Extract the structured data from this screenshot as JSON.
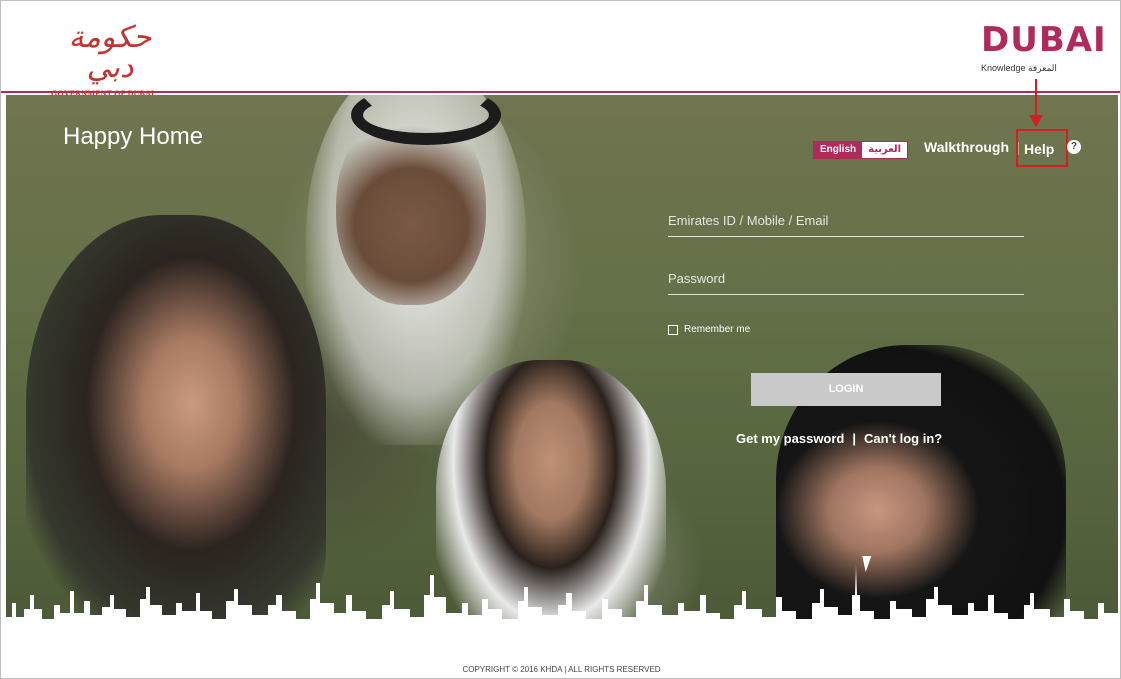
{
  "header": {
    "gov_logo_ar": "حكومة دبي",
    "gov_logo_en": "GOVERNMENT OF DUBAI",
    "kd_logo_main": "DUBAI",
    "kd_logo_sub": "Knowledge المعرفة"
  },
  "hero": {
    "title": "Happy Home"
  },
  "topnav": {
    "lang_en": "English",
    "lang_ar": "العربية",
    "walkthrough": "Walkthrough",
    "separator": "|",
    "help": "Help",
    "help_icon_glyph": "?"
  },
  "login_form": {
    "id_placeholder": "Emirates ID / Mobile / Email",
    "password_placeholder": "Password",
    "remember_label": "Remember me",
    "login_label": "LOGIN",
    "get_password": "Get my password",
    "links_separator": "|",
    "cant_login": "Can't log in?"
  },
  "footer": {
    "copyright": "COPYRIGHT © 2016 KHDA | ALL RIGHTS RESERVED"
  },
  "colors": {
    "brand": "#b02a5b",
    "annotation": "#d21f1f",
    "gov_red": "#c4322f"
  },
  "icons": {
    "help": "question-circle-icon",
    "checkbox": "checkbox-icon",
    "cursor": "mouse-pointer-icon",
    "arrow": "annotation-arrow-icon"
  }
}
